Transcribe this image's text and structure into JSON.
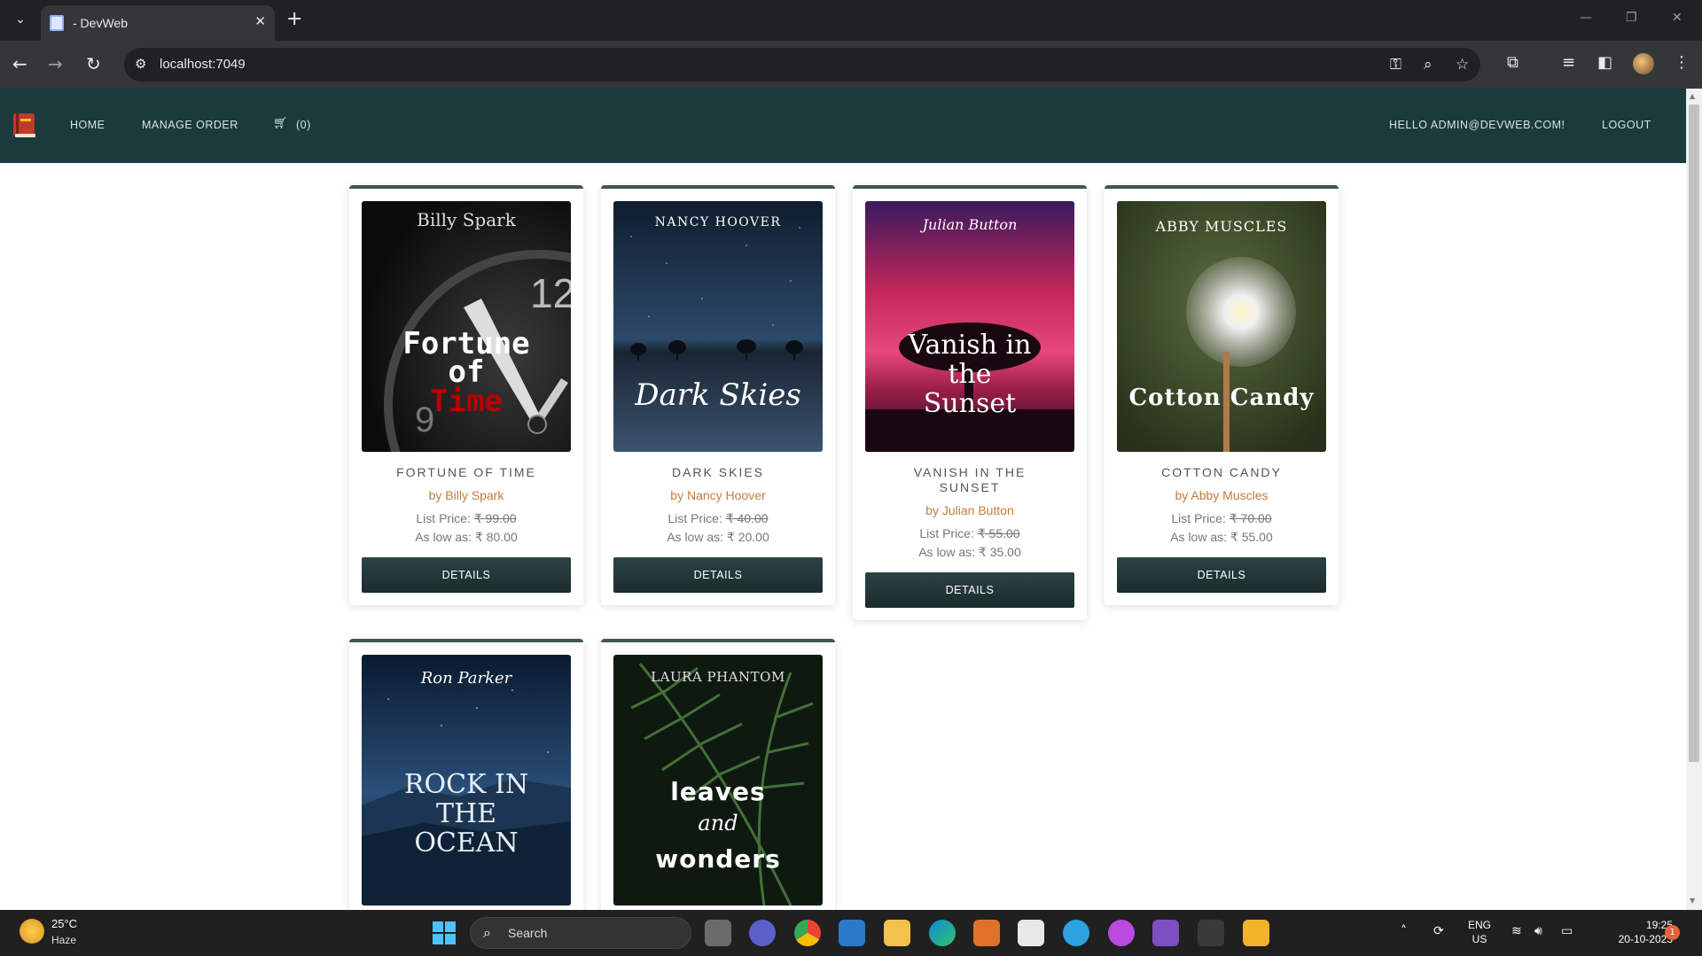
{
  "browser": {
    "tab_title": "- DevWeb",
    "url": "localhost:7049",
    "tab_menu_icon": "chevron-down-icon",
    "new_tab_label": "+"
  },
  "navbar": {
    "home": "HOME",
    "manage_order": "MANAGE ORDER",
    "cart_count": "(0)",
    "greeting": "HELLO ADMIN@DEVWEB.COM!",
    "logout": "LOGOUT",
    "background": "#1b3a3b"
  },
  "products": [
    {
      "title": "FORTUNE OF TIME",
      "author": "by Billy Spark",
      "list_label": "List Price:",
      "list_price": "₹ 99.00",
      "low_label": "As low as:",
      "low_price": "₹ 80.00",
      "button": "DETAILS",
      "cover": {
        "author": "Billy Spark",
        "title_lines": [
          "Fortune",
          "of",
          "Time"
        ]
      }
    },
    {
      "title": "DARK SKIES",
      "author": "by Nancy Hoover",
      "list_label": "List Price:",
      "list_price": "₹ 40.00",
      "low_label": "As low as:",
      "low_price": "₹ 20.00",
      "button": "DETAILS",
      "cover": {
        "author": "NANCY HOOVER",
        "title_lines": [
          "Dark Skies"
        ]
      }
    },
    {
      "title_lines": [
        "VANISH IN THE",
        "SUNSET"
      ],
      "author": "by Julian Button",
      "list_label": "List Price:",
      "list_price": "₹ 55.00",
      "low_label": "As low as:",
      "low_price": "₹ 35.00",
      "button": "DETAILS",
      "cover": {
        "author": "Julian Button",
        "title_lines": [
          "Vanish in",
          "the",
          "Sunset"
        ]
      }
    },
    {
      "title": "COTTON CANDY",
      "author": "by Abby Muscles",
      "list_label": "List Price:",
      "list_price": "₹ 70.00",
      "low_label": "As low as:",
      "low_price": "₹ 55.00",
      "button": "DETAILS",
      "cover": {
        "author": "ABBY MUSCLES",
        "title_lines": [
          "Cotton Candy"
        ]
      }
    },
    {
      "cover": {
        "author": "Ron Parker",
        "title_lines": [
          "ROCK IN",
          "THE",
          "OCEAN"
        ]
      }
    },
    {
      "cover": {
        "author": "LAURA PHANTOM",
        "title_lines": [
          "leaves",
          "and",
          "wonders"
        ]
      }
    }
  ],
  "taskbar": {
    "temp": "25°C",
    "weather": "Haze",
    "search": "Search",
    "lang_line1": "ENG",
    "lang_line2": "US",
    "time": "19:25",
    "date": "20-10-2023",
    "notifications": "1"
  }
}
